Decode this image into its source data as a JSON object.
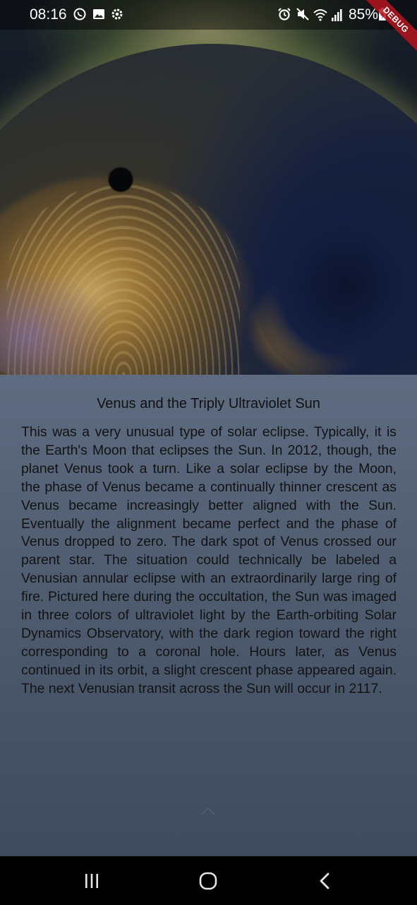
{
  "status_bar": {
    "time": "08:16",
    "battery": "85%",
    "icons": [
      "whatsapp-icon",
      "gallery-icon",
      "settings-icon",
      "alarm-icon",
      "mute-icon",
      "wifi-icon",
      "signal-icon",
      "battery-charging-icon"
    ]
  },
  "debug_banner": "DEBUG",
  "article": {
    "title": "Venus and the Triply Ultraviolet Sun",
    "explanation": "This was a very unusual type of solar eclipse. Typically, it is the Earth's Moon that eclipses the Sun. In 2012, though, the planet Venus took a turn.  Like a solar eclipse by the Moon, the phase of Venus became a continually thinner crescent as Venus became increasingly better aligned with the Sun. Eventually the alignment became perfect and the phase of Venus dropped to zero.  The dark spot of Venus crossed our parent star.  The situation could technically be labeled a Venusian annular eclipse with an extraordinarily large ring of fire.  Pictured here during the occultation, the Sun was imaged in three colors of ultraviolet light by the Earth-orbiting Solar Dynamics Observatory, with the dark region toward the right corresponding to a coronal hole. Hours later, as Venus continued in its orbit, a slight crescent phase appeared again.  The next Venusian transit across the Sun will occur in 2117."
  },
  "nav_bar": {
    "buttons": [
      "recent-apps-icon",
      "home-icon",
      "back-icon"
    ]
  },
  "colors": {
    "panel": "#56637a",
    "status_bar": "#000000",
    "nav_bar": "#000000",
    "debug_ribbon": "#b4141e"
  }
}
